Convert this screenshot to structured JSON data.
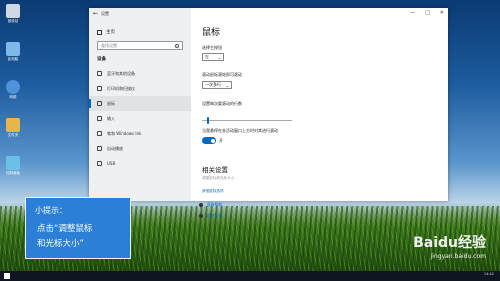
{
  "desktop": {
    "icons": [
      {
        "label": "回收站",
        "color": "#cfd8e3"
      },
      {
        "label": "此电脑",
        "color": "#7fb8ea"
      },
      {
        "label": "网络",
        "color": "#4f92d9"
      },
      {
        "label": "文件夹",
        "color": "#e6b64a"
      },
      {
        "label": "控制面板",
        "color": "#6cc0e5"
      }
    ]
  },
  "window": {
    "title": "设置",
    "controls": [
      "—",
      "□",
      "✕"
    ],
    "sidebar": {
      "home": "主页",
      "search_placeholder": "查找设置",
      "section": "设备",
      "items": [
        {
          "label": "蓝牙和其他设备",
          "active": false
        },
        {
          "label": "打印机和扫描仪",
          "active": false
        },
        {
          "label": "鼠标",
          "active": true
        },
        {
          "label": "输入",
          "active": false
        },
        {
          "label": "笔和 Windows Ink",
          "active": false
        },
        {
          "label": "自动播放",
          "active": false
        },
        {
          "label": "USB",
          "active": false
        }
      ]
    },
    "main": {
      "title": "鼠标",
      "primary_button_label": "选择主按钮",
      "primary_button_value": "左",
      "wheel_label": "滚动鼠标滚轮即可滚动",
      "wheel_value": "一次多行",
      "lines_label": "设置每次要滚动的行数",
      "inactive_scroll_label": "当我悬停在非活动窗口上方时对其进行滚动",
      "toggle_state": "开",
      "related_title": "相关设置",
      "related_desc": "调整鼠标和光标大小",
      "related_link": "其他鼠标选项",
      "help": [
        "获取帮助",
        "提供反馈"
      ]
    }
  },
  "tip": {
    "heading": "小提示：",
    "line1": "点击“调整鼠标",
    "line2": "和光标大小”"
  },
  "watermark": {
    "brand": "Baidu经验",
    "url": "jingyan.baidu.com"
  },
  "taskbar": {
    "time": "14:42"
  },
  "colors": {
    "accent": "#0067c0",
    "tip_bg": "#2b7fd6"
  }
}
